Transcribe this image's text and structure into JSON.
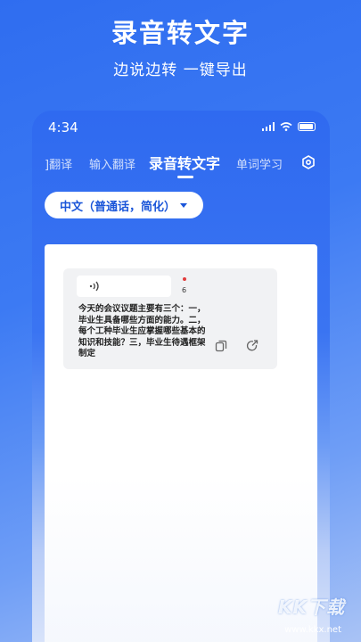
{
  "promo": {
    "headline": "录音转文字",
    "subline": "边说边转 一键导出"
  },
  "status_bar": {
    "time": "4:34"
  },
  "tabs": [
    {
      "label": "翻译",
      "partial_prefix": "]"
    },
    {
      "label": "输入翻译"
    },
    {
      "label": "录音转文字",
      "active": true
    },
    {
      "label": "单词学习"
    }
  ],
  "language_select": {
    "value": "中文（普通话，简化）"
  },
  "note": {
    "recording_count": "6",
    "text": "今天的会议议题主要有三个：一，毕业生具备哪些方面的能力。二，每个工种毕业生应掌握哪些基本的知识和技能？三，毕业生待遇框架制定"
  },
  "watermark": {
    "logo": "KK下载",
    "url": "www.kkx.net"
  },
  "colors": {
    "brand_blue": "#2f6df0",
    "select_text": "#1b56d9",
    "record_dot": "#e23b3b"
  },
  "icons": [
    "signal-icon",
    "wifi-icon",
    "battery-icon",
    "settings-icon",
    "chevron-down-icon",
    "sound-wave-icon",
    "copy-icon",
    "export-icon"
  ]
}
